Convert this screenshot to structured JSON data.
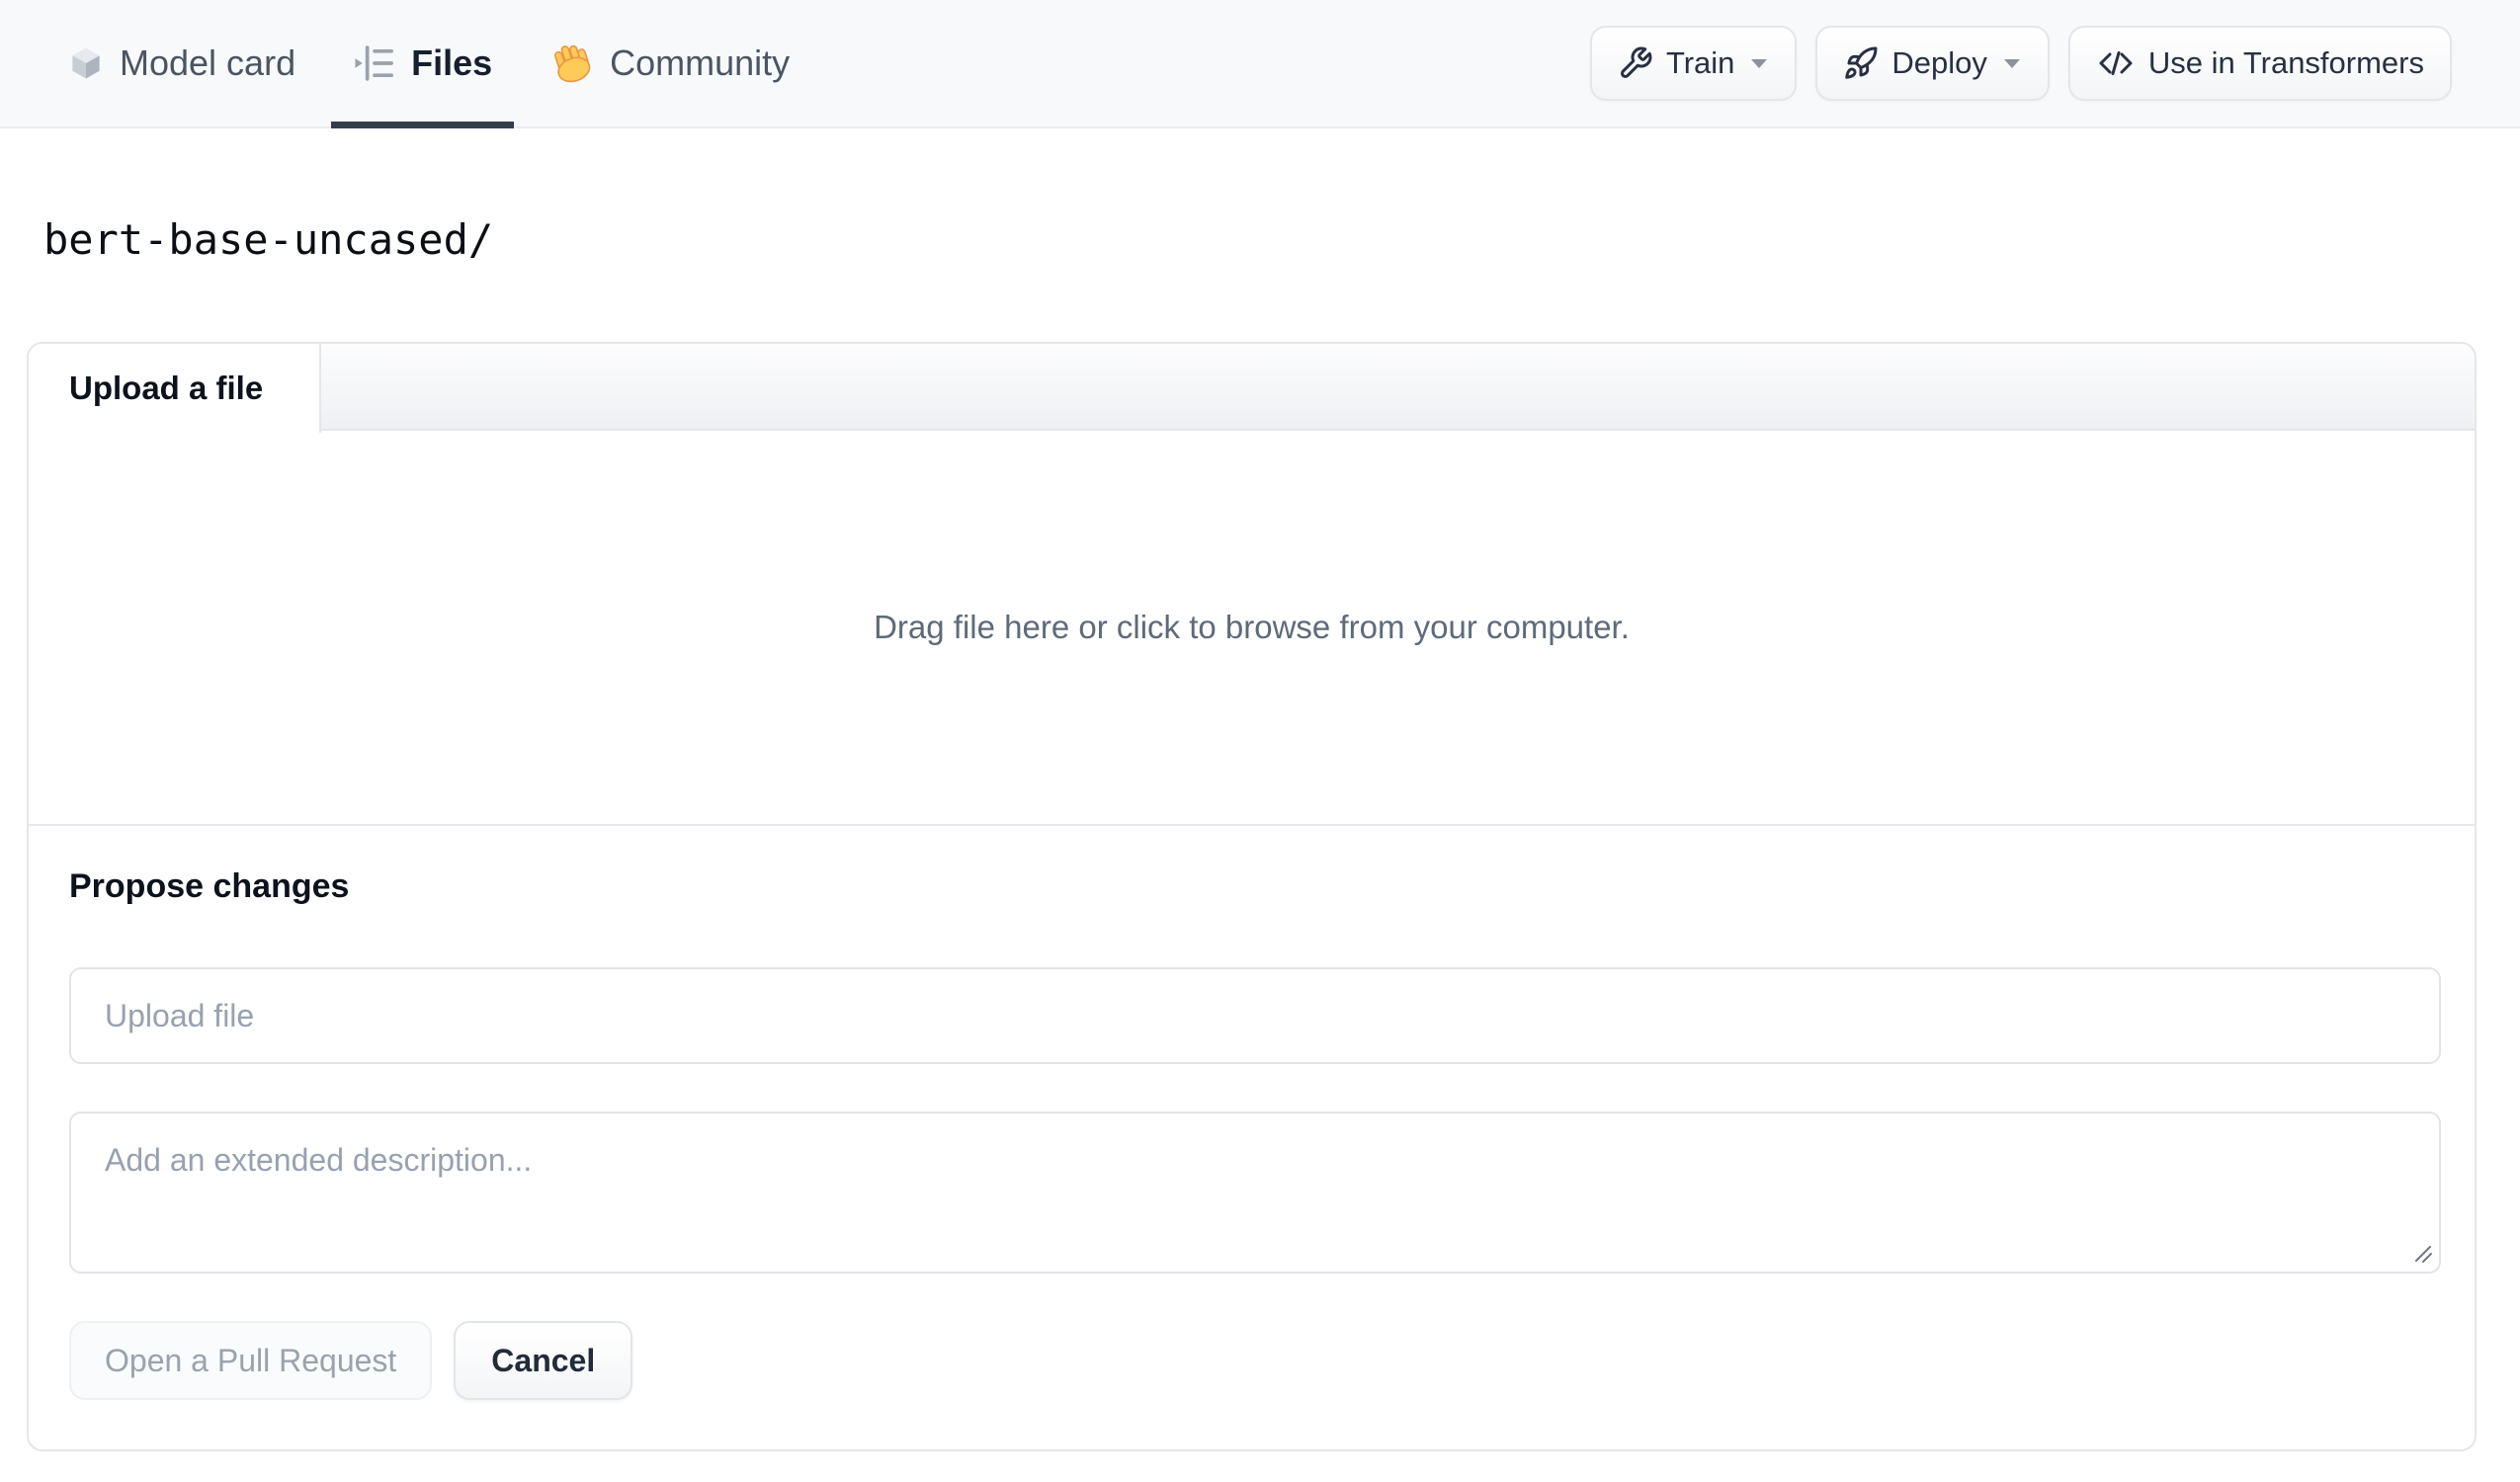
{
  "header": {
    "tabs": [
      {
        "label": "Model card",
        "icon": "cube-icon",
        "active": false
      },
      {
        "label": "Files",
        "icon": "file-versions-icon",
        "active": true
      },
      {
        "label": "Community",
        "icon": "waving-hand-icon",
        "active": false
      }
    ],
    "actions": [
      {
        "label": "Train",
        "icon": "wrench-icon",
        "has_caret": true
      },
      {
        "label": "Deploy",
        "icon": "rocket-icon",
        "has_caret": true
      },
      {
        "label": "Use in Transformers",
        "icon": "code-icon",
        "has_caret": false
      }
    ]
  },
  "path_heading": "bert-base-uncased/",
  "upload_panel": {
    "tab_label": "Upload a file",
    "dropzone_text": "Drag file here or click to browse from your computer.",
    "propose": {
      "heading": "Propose changes",
      "filename_placeholder": "Upload file",
      "description_placeholder": "Add an extended description...",
      "primary_button": "Open a Pull Request",
      "cancel_button": "Cancel"
    }
  },
  "colors": {
    "topbar_bg": "#f8f9fb",
    "active_tab_underline": "#343d4e",
    "panel_border": "#e4e6ea",
    "muted_text": "#5e6a7a",
    "placeholder_text": "#98a1af",
    "dark_text": "#0d131c",
    "hand_icon_yellow": "#fdcb58"
  }
}
